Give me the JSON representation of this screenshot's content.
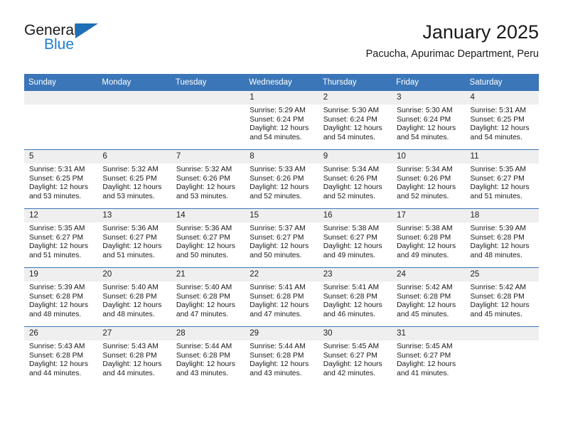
{
  "brand": {
    "name_top": "General",
    "name_bottom": "Blue",
    "accent_color": "#1f7fd0",
    "triangle_color": "#1f6fb6"
  },
  "header": {
    "title": "January 2025",
    "subtitle": "Pacucha, Apurimac Department, Peru"
  },
  "theme": {
    "header_blue": "#3a76b8",
    "daynum_band": "#efefef",
    "text": "#1a1a1a"
  },
  "weekday_headers": [
    "Sunday",
    "Monday",
    "Tuesday",
    "Wednesday",
    "Thursday",
    "Friday",
    "Saturday"
  ],
  "weeks": [
    [
      {
        "day": "",
        "sunrise": "",
        "sunset": "",
        "daylight": "",
        "daylight2": ""
      },
      {
        "day": "",
        "sunrise": "",
        "sunset": "",
        "daylight": "",
        "daylight2": ""
      },
      {
        "day": "",
        "sunrise": "",
        "sunset": "",
        "daylight": "",
        "daylight2": ""
      },
      {
        "day": "1",
        "sunrise": "Sunrise: 5:29 AM",
        "sunset": "Sunset: 6:24 PM",
        "daylight": "Daylight: 12 hours",
        "daylight2": "and 54 minutes."
      },
      {
        "day": "2",
        "sunrise": "Sunrise: 5:30 AM",
        "sunset": "Sunset: 6:24 PM",
        "daylight": "Daylight: 12 hours",
        "daylight2": "and 54 minutes."
      },
      {
        "day": "3",
        "sunrise": "Sunrise: 5:30 AM",
        "sunset": "Sunset: 6:24 PM",
        "daylight": "Daylight: 12 hours",
        "daylight2": "and 54 minutes."
      },
      {
        "day": "4",
        "sunrise": "Sunrise: 5:31 AM",
        "sunset": "Sunset: 6:25 PM",
        "daylight": "Daylight: 12 hours",
        "daylight2": "and 54 minutes."
      }
    ],
    [
      {
        "day": "5",
        "sunrise": "Sunrise: 5:31 AM",
        "sunset": "Sunset: 6:25 PM",
        "daylight": "Daylight: 12 hours",
        "daylight2": "and 53 minutes."
      },
      {
        "day": "6",
        "sunrise": "Sunrise: 5:32 AM",
        "sunset": "Sunset: 6:25 PM",
        "daylight": "Daylight: 12 hours",
        "daylight2": "and 53 minutes."
      },
      {
        "day": "7",
        "sunrise": "Sunrise: 5:32 AM",
        "sunset": "Sunset: 6:26 PM",
        "daylight": "Daylight: 12 hours",
        "daylight2": "and 53 minutes."
      },
      {
        "day": "8",
        "sunrise": "Sunrise: 5:33 AM",
        "sunset": "Sunset: 6:26 PM",
        "daylight": "Daylight: 12 hours",
        "daylight2": "and 52 minutes."
      },
      {
        "day": "9",
        "sunrise": "Sunrise: 5:34 AM",
        "sunset": "Sunset: 6:26 PM",
        "daylight": "Daylight: 12 hours",
        "daylight2": "and 52 minutes."
      },
      {
        "day": "10",
        "sunrise": "Sunrise: 5:34 AM",
        "sunset": "Sunset: 6:26 PM",
        "daylight": "Daylight: 12 hours",
        "daylight2": "and 52 minutes."
      },
      {
        "day": "11",
        "sunrise": "Sunrise: 5:35 AM",
        "sunset": "Sunset: 6:27 PM",
        "daylight": "Daylight: 12 hours",
        "daylight2": "and 51 minutes."
      }
    ],
    [
      {
        "day": "12",
        "sunrise": "Sunrise: 5:35 AM",
        "sunset": "Sunset: 6:27 PM",
        "daylight": "Daylight: 12 hours",
        "daylight2": "and 51 minutes."
      },
      {
        "day": "13",
        "sunrise": "Sunrise: 5:36 AM",
        "sunset": "Sunset: 6:27 PM",
        "daylight": "Daylight: 12 hours",
        "daylight2": "and 51 minutes."
      },
      {
        "day": "14",
        "sunrise": "Sunrise: 5:36 AM",
        "sunset": "Sunset: 6:27 PM",
        "daylight": "Daylight: 12 hours",
        "daylight2": "and 50 minutes."
      },
      {
        "day": "15",
        "sunrise": "Sunrise: 5:37 AM",
        "sunset": "Sunset: 6:27 PM",
        "daylight": "Daylight: 12 hours",
        "daylight2": "and 50 minutes."
      },
      {
        "day": "16",
        "sunrise": "Sunrise: 5:38 AM",
        "sunset": "Sunset: 6:27 PM",
        "daylight": "Daylight: 12 hours",
        "daylight2": "and 49 minutes."
      },
      {
        "day": "17",
        "sunrise": "Sunrise: 5:38 AM",
        "sunset": "Sunset: 6:28 PM",
        "daylight": "Daylight: 12 hours",
        "daylight2": "and 49 minutes."
      },
      {
        "day": "18",
        "sunrise": "Sunrise: 5:39 AM",
        "sunset": "Sunset: 6:28 PM",
        "daylight": "Daylight: 12 hours",
        "daylight2": "and 48 minutes."
      }
    ],
    [
      {
        "day": "19",
        "sunrise": "Sunrise: 5:39 AM",
        "sunset": "Sunset: 6:28 PM",
        "daylight": "Daylight: 12 hours",
        "daylight2": "and 48 minutes."
      },
      {
        "day": "20",
        "sunrise": "Sunrise: 5:40 AM",
        "sunset": "Sunset: 6:28 PM",
        "daylight": "Daylight: 12 hours",
        "daylight2": "and 48 minutes."
      },
      {
        "day": "21",
        "sunrise": "Sunrise: 5:40 AM",
        "sunset": "Sunset: 6:28 PM",
        "daylight": "Daylight: 12 hours",
        "daylight2": "and 47 minutes."
      },
      {
        "day": "22",
        "sunrise": "Sunrise: 5:41 AM",
        "sunset": "Sunset: 6:28 PM",
        "daylight": "Daylight: 12 hours",
        "daylight2": "and 47 minutes."
      },
      {
        "day": "23",
        "sunrise": "Sunrise: 5:41 AM",
        "sunset": "Sunset: 6:28 PM",
        "daylight": "Daylight: 12 hours",
        "daylight2": "and 46 minutes."
      },
      {
        "day": "24",
        "sunrise": "Sunrise: 5:42 AM",
        "sunset": "Sunset: 6:28 PM",
        "daylight": "Daylight: 12 hours",
        "daylight2": "and 45 minutes."
      },
      {
        "day": "25",
        "sunrise": "Sunrise: 5:42 AM",
        "sunset": "Sunset: 6:28 PM",
        "daylight": "Daylight: 12 hours",
        "daylight2": "and 45 minutes."
      }
    ],
    [
      {
        "day": "26",
        "sunrise": "Sunrise: 5:43 AM",
        "sunset": "Sunset: 6:28 PM",
        "daylight": "Daylight: 12 hours",
        "daylight2": "and 44 minutes."
      },
      {
        "day": "27",
        "sunrise": "Sunrise: 5:43 AM",
        "sunset": "Sunset: 6:28 PM",
        "daylight": "Daylight: 12 hours",
        "daylight2": "and 44 minutes."
      },
      {
        "day": "28",
        "sunrise": "Sunrise: 5:44 AM",
        "sunset": "Sunset: 6:28 PM",
        "daylight": "Daylight: 12 hours",
        "daylight2": "and 43 minutes."
      },
      {
        "day": "29",
        "sunrise": "Sunrise: 5:44 AM",
        "sunset": "Sunset: 6:28 PM",
        "daylight": "Daylight: 12 hours",
        "daylight2": "and 43 minutes."
      },
      {
        "day": "30",
        "sunrise": "Sunrise: 5:45 AM",
        "sunset": "Sunset: 6:27 PM",
        "daylight": "Daylight: 12 hours",
        "daylight2": "and 42 minutes."
      },
      {
        "day": "31",
        "sunrise": "Sunrise: 5:45 AM",
        "sunset": "Sunset: 6:27 PM",
        "daylight": "Daylight: 12 hours",
        "daylight2": "and 41 minutes."
      },
      {
        "day": "",
        "sunrise": "",
        "sunset": "",
        "daylight": "",
        "daylight2": ""
      }
    ]
  ]
}
